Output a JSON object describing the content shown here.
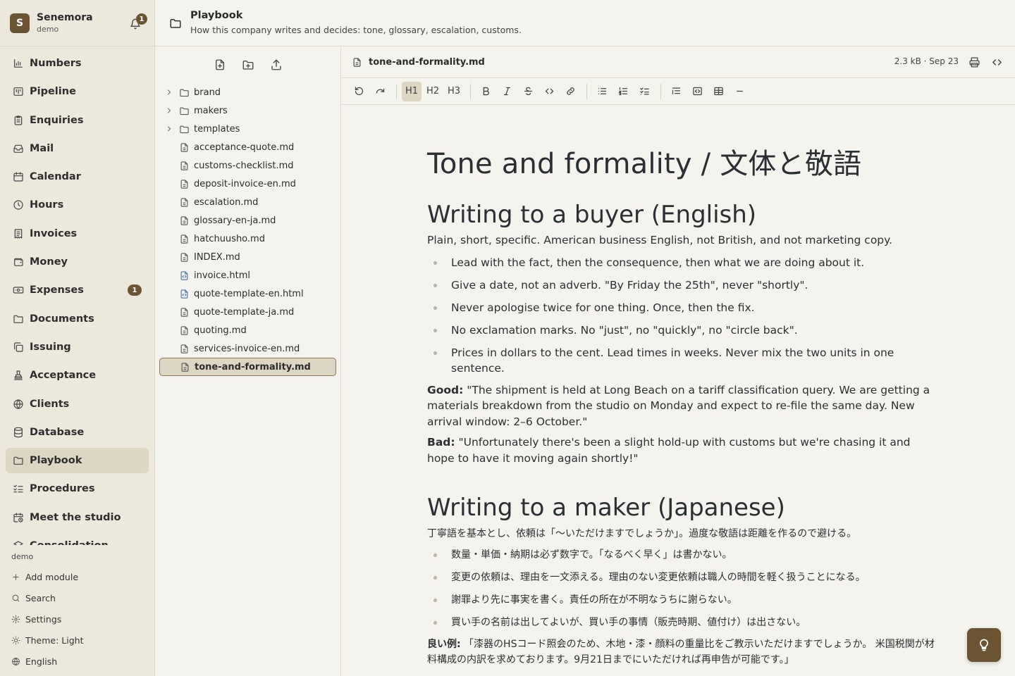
{
  "brand": {
    "initial": "S",
    "name": "Senemora",
    "workspace": "demo",
    "notifications": "1"
  },
  "nav": [
    {
      "id": "numbers",
      "label": "Numbers",
      "icon": "bar-chart-icon"
    },
    {
      "id": "pipeline",
      "label": "Pipeline",
      "icon": "kanban-icon"
    },
    {
      "id": "enquiries",
      "label": "Enquiries",
      "icon": "clipboard-icon"
    },
    {
      "id": "mail",
      "label": "Mail",
      "icon": "inbox-icon"
    },
    {
      "id": "calendar",
      "label": "Calendar",
      "icon": "calendar-icon"
    },
    {
      "id": "hours",
      "label": "Hours",
      "icon": "clock-icon"
    },
    {
      "id": "invoices",
      "label": "Invoices",
      "icon": "receipt-icon"
    },
    {
      "id": "money",
      "label": "Money",
      "icon": "wallet-icon"
    },
    {
      "id": "expenses",
      "label": "Expenses",
      "icon": "banknote-icon",
      "badge": "1"
    },
    {
      "id": "documents",
      "label": "Documents",
      "icon": "folder-icon"
    },
    {
      "id": "issuing",
      "label": "Issuing",
      "icon": "copy-icon"
    },
    {
      "id": "acceptance",
      "label": "Acceptance",
      "icon": "stamp-icon"
    },
    {
      "id": "clients",
      "label": "Clients",
      "icon": "globe-icon"
    },
    {
      "id": "database",
      "label": "Database",
      "icon": "database-icon"
    },
    {
      "id": "playbook",
      "label": "Playbook",
      "icon": "folder-icon",
      "active": true
    },
    {
      "id": "procedures",
      "label": "Procedures",
      "icon": "list-checks-icon"
    },
    {
      "id": "meet-the-studio",
      "label": "Meet the studio",
      "icon": "calendar-clock-icon"
    },
    {
      "id": "consolidation",
      "label": "Consolidation",
      "icon": "layers-icon"
    }
  ],
  "footer": {
    "workspace": "demo",
    "items": [
      {
        "id": "add-module",
        "label": "Add module",
        "icon": "plus-icon"
      },
      {
        "id": "search",
        "label": "Search",
        "icon": "search-icon"
      },
      {
        "id": "settings",
        "label": "Settings",
        "icon": "gear-icon"
      },
      {
        "id": "theme",
        "label": "Theme: Light",
        "icon": "sun-icon"
      },
      {
        "id": "language",
        "label": "English",
        "icon": "globe-icon"
      }
    ]
  },
  "header": {
    "title": "Playbook",
    "subtitle": "How this company writes and decides: tone, glossary, escalation, customs."
  },
  "tree": [
    {
      "type": "folder",
      "name": "brand"
    },
    {
      "type": "folder",
      "name": "makers"
    },
    {
      "type": "folder",
      "name": "templates"
    },
    {
      "type": "md",
      "name": "acceptance-quote.md"
    },
    {
      "type": "md",
      "name": "customs-checklist.md"
    },
    {
      "type": "md",
      "name": "deposit-invoice-en.md"
    },
    {
      "type": "md",
      "name": "escalation.md"
    },
    {
      "type": "md",
      "name": "glossary-en-ja.md"
    },
    {
      "type": "md",
      "name": "hatchuusho.md"
    },
    {
      "type": "md",
      "name": "INDEX.md"
    },
    {
      "type": "html",
      "name": "invoice.html"
    },
    {
      "type": "html",
      "name": "quote-template-en.html"
    },
    {
      "type": "md",
      "name": "quote-template-ja.md"
    },
    {
      "type": "md",
      "name": "quoting.md"
    },
    {
      "type": "md",
      "name": "services-invoice-en.md"
    },
    {
      "type": "md",
      "name": "tone-and-formality.md",
      "active": true
    }
  ],
  "file": {
    "name": "tone-and-formality.md",
    "meta": "2.3 kB · Sep 23"
  },
  "toolbar": {
    "h1": "H1",
    "h2": "H2",
    "h3": "H3"
  },
  "doc": {
    "title": "Tone and formality / 文体と敬語",
    "en": {
      "heading": "Writing to a buyer (English)",
      "intro": "Plain, short, specific. American business English, not British, and not marketing copy.",
      "bullets": [
        "Lead with the fact, then the consequence, then what we are doing about it.",
        "Give a date, not an adverb. \"By Friday the 25th\", never \"shortly\".",
        "Never apologise twice for one thing. Once, then the fix.",
        "No exclamation marks. No \"just\", no \"quickly\", no \"circle back\".",
        "Prices in dollars to the cent. Lead times in weeks. Never mix the two units in one sentence."
      ],
      "good_label": "Good:",
      "good_text": " \"The shipment is held at Long Beach on a tariff classification query. We are getting a materials breakdown from the studio on Monday and expect to re-file the same day. New arrival window: 2–6 October.\"",
      "bad_label": "Bad:",
      "bad_text": " \"Unfortunately there's been a slight hold-up with customs but we're chasing it and hope to have it moving again shortly!\""
    },
    "ja": {
      "heading": "Writing to a maker (Japanese)",
      "intro": "丁寧語を基本とし、依頼は「〜いただけますでしょうか」。過度な敬語は距離を作るので避ける。",
      "bullets": [
        "数量・単価・納期は必ず数字で。「なるべく早く」は書かない。",
        "変更の依頼は、理由を一文添える。理由のない変更依頼は職人の時間を軽く扱うことになる。",
        "謝罪より先に事実を書く。責任の所在が不明なうちに謝らない。",
        "買い手の名前は出してよいが、買い手の事情（販売時期、値付け）は出さない。"
      ],
      "good_label": "良い例:",
      "good_text": " 「漆器のHSコード照会のため、木地・漆・顔料の重量比をご教示いただけますでしょうか。 米国税関が材料構成の内訳を求めております。9月21日までにいただければ再申告が可能です。」"
    }
  },
  "fab": {
    "icon": "lightbulb-icon"
  }
}
